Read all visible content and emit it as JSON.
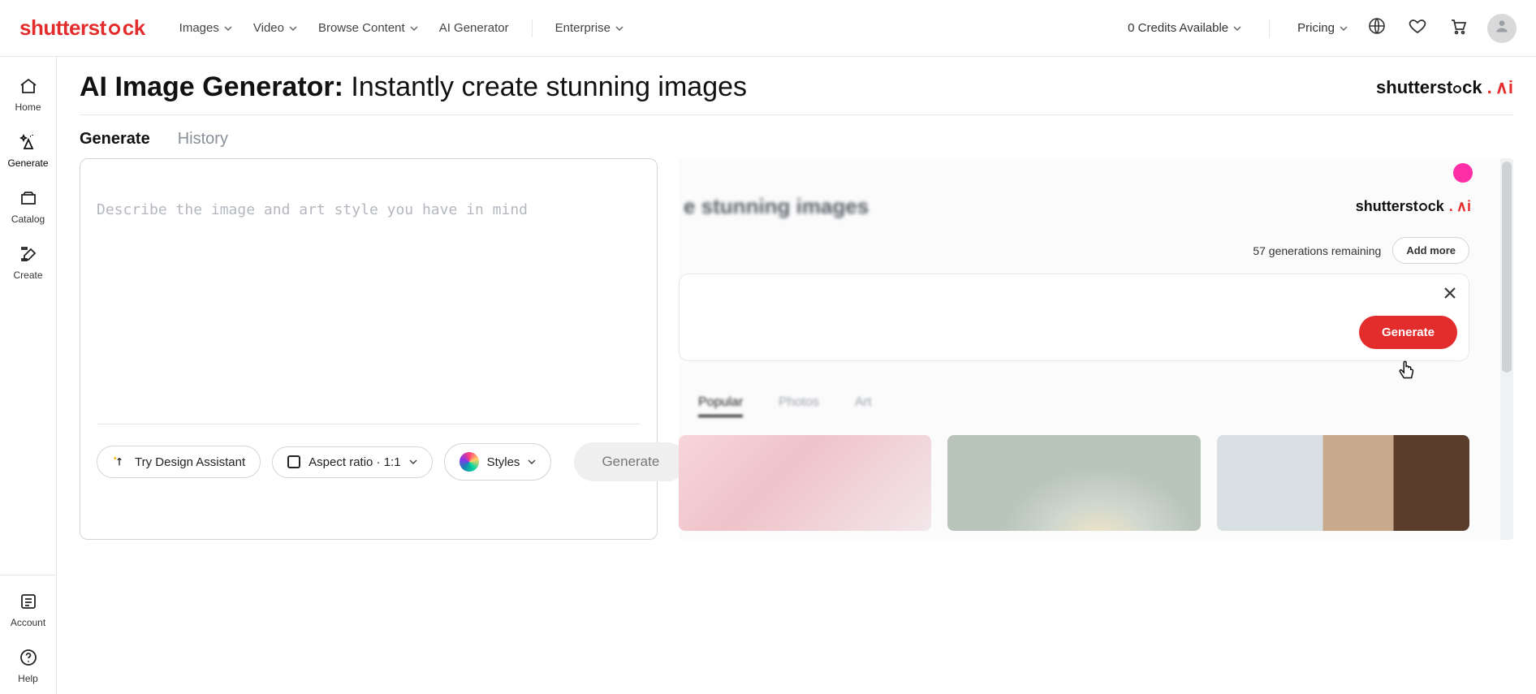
{
  "header": {
    "logo_text": "shutterstock",
    "nav": {
      "images": "Images",
      "video": "Video",
      "browse": "Browse Content",
      "ai": "AI Generator",
      "enterprise": "Enterprise"
    },
    "credits_label": "0 Credits Available",
    "pricing_label": "Pricing"
  },
  "sidebar": {
    "home": "Home",
    "generate": "Generate",
    "catalog": "Catalog",
    "create": "Create",
    "account": "Account",
    "help": "Help"
  },
  "page": {
    "title_strong": "AI Image Generator:",
    "title_rest": " Instantly create stunning images",
    "brand_ai_text": "shutterstock",
    "brand_ai_suffix": ".",
    "brand_ai_ai": "∧i"
  },
  "tabs": {
    "generate": "Generate",
    "history": "History"
  },
  "prompt": {
    "placeholder": "Describe the image and art style you have in mind",
    "value": ""
  },
  "controls": {
    "design_assistant": "Try Design Assistant",
    "aspect_ratio_prefix": "Aspect ratio · ",
    "aspect_ratio_value": "1:1",
    "styles_label": "Styles",
    "generate_label": "Generate"
  },
  "demo": {
    "blur_title": "e stunning images",
    "remaining_label": "57 generations remaining",
    "add_more": "Add more",
    "generate_label": "Generate",
    "tabs": {
      "popular": "Popular",
      "photos": "Photos",
      "art": "Art"
    },
    "brand_ai_text": "shutterstock",
    "brand_ai_suffix": ".",
    "brand_ai_ai": "∧i"
  }
}
